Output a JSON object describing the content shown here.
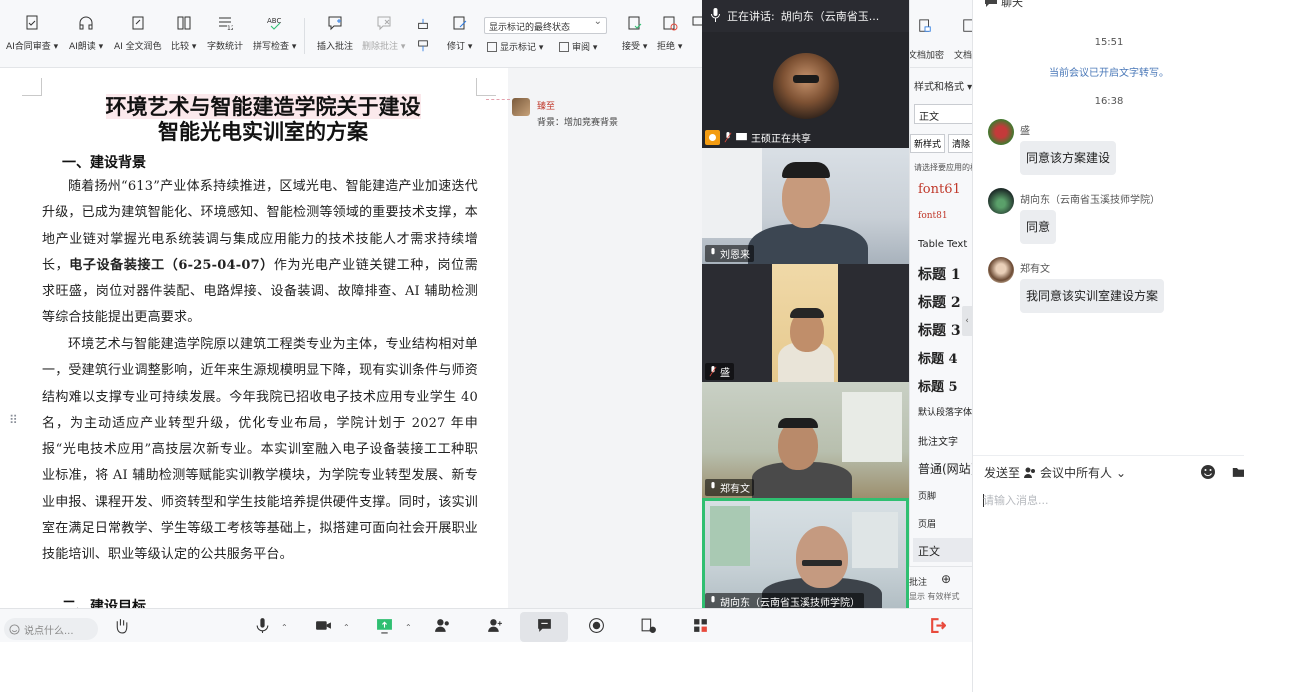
{
  "toolbar": {
    "items": [
      {
        "label": "AI合同审查 ▾"
      },
      {
        "label": "AI朗读 ▾"
      },
      {
        "label": "AI 全文润色"
      },
      {
        "label": "比较 ▾"
      },
      {
        "label": "字数统计"
      },
      {
        "label": "拼写检查 ▾",
        "icon_text": "ABC"
      },
      {
        "label": "插入批注"
      },
      {
        "label": "删除批注 ▾"
      },
      {
        "label": "修订 ▾"
      },
      {
        "label": "接受 ▾"
      },
      {
        "label": "拒绝 ▾"
      },
      {
        "label": "文档加密"
      },
      {
        "label": "文档"
      }
    ],
    "markup_select": "显示标记的最终状态",
    "show_markup": "显示标记 ▾",
    "review": "审阅 ▾"
  },
  "document": {
    "title_line1": "环境艺术与智能建造学院关于建设",
    "title_line2": "智能光电实训室的方案",
    "heading1": "一、建设背景",
    "para1_a": "随着扬州“613”产业体系持续推进，区域光电、智能建造产业加速迭代升级，已成为建筑智能化、环境感知、智能检测等领域的重要技术支撑，本地产业链对掌握光电系统装调与集成应用能力的技术技能人才需求持续增长，",
    "para1_bold": "电子设备装接工（6-25-04-07）",
    "para1_b": "作为光电产业链关键工种，岗位需求旺盛，岗位对器件装配、电路焊接、设备装调、故障排查、AI 辅助检测等综合技能提出更高要求。",
    "para2": "环境艺术与智能建造学院原以建筑工程类专业为主体，专业结构相对单一，受建筑行业调整影响，近年来生源规模明显下降，现有实训条件与师资结构难以支撑专业可持续发展。今年我院已招收电子技术应用专业学生 40 名，为主动适应产业转型升级，优化专业布局，学院计划于 2027 年申报“光电技术应用”高技层次新专业。本实训室融入电子设备装接工工种职业标准，将 AI 辅助检测等赋能实训教学模块，为学院专业转型发展、新专业申报、课程开发、师资转型和学生技能培养提供硬件支撑。同时，该实训室在满足日常教学、学生等级工考核等基础上，拟搭建可面向社会开展职业技能培训、职业等级认定的公共服务平台。",
    "heading2": "二、建设目标"
  },
  "comment": {
    "author": "臻至",
    "text": "背景：增加竞赛背景"
  },
  "style_panel": {
    "header": "样式和格式 ▾",
    "current": "正文",
    "btn_new": "新样式",
    "btn_clear": "清除",
    "hint": "请选择要应用的格",
    "items": [
      {
        "label": "font61"
      },
      {
        "label": "font81"
      },
      {
        "label": "Table Text"
      },
      {
        "label": "标题 1"
      },
      {
        "label": "标题 2"
      },
      {
        "label": "标题 3"
      },
      {
        "label": "标题 4"
      },
      {
        "label": "标题 5"
      },
      {
        "label": "默认段落字体"
      },
      {
        "label": "批注文字"
      },
      {
        "label": "普通(网站)"
      },
      {
        "label": "页脚"
      },
      {
        "label": "页眉"
      },
      {
        "label": "正文"
      }
    ],
    "bottom_comment": "批注",
    "bottom_sub": "显示   有效样式"
  },
  "video": {
    "speaking_label": "正在讲话:",
    "speaking_name": "胡向东（云南省玉...",
    "tiles": [
      {
        "name": "王硕正在共享"
      },
      {
        "name": "刘恩来"
      },
      {
        "name": "盛"
      },
      {
        "name": "郑有文"
      },
      {
        "name": "胡向东（云南省玉溪技师学院）"
      }
    ]
  },
  "meeting_bar": {
    "say_placeholder": "说点什么...",
    "buttons": [
      {
        "icon": "mic-icon"
      },
      {
        "icon": "camera-icon"
      },
      {
        "icon": "share-screen-icon"
      },
      {
        "icon": "participants-icon"
      },
      {
        "icon": "invite-icon"
      },
      {
        "icon": "chat-icon"
      },
      {
        "icon": "record-icon"
      },
      {
        "icon": "apps-icon"
      },
      {
        "icon": "leave-icon"
      }
    ]
  },
  "chat": {
    "header": "聊天",
    "time1": "15:51",
    "notice": "当前会议已开启文字转写。",
    "time2": "16:38",
    "messages": [
      {
        "sender": "盛",
        "text": "同意该方案建设"
      },
      {
        "sender": "胡向东（云南省玉溪技师学院）",
        "text": "同意"
      },
      {
        "sender": "郑有文",
        "text": "我同意该实训室建设方案"
      }
    ],
    "send_to_label": "发送至",
    "send_to_target": "会议中所有人",
    "input_placeholder": "请输入消息..."
  },
  "colors": {
    "accent_green": "#2fbf71",
    "chat_notice": "#4a78b8",
    "comment_red": "#c0392b",
    "leave_red": "#e84a3c",
    "share_orange": "#f39c12"
  }
}
